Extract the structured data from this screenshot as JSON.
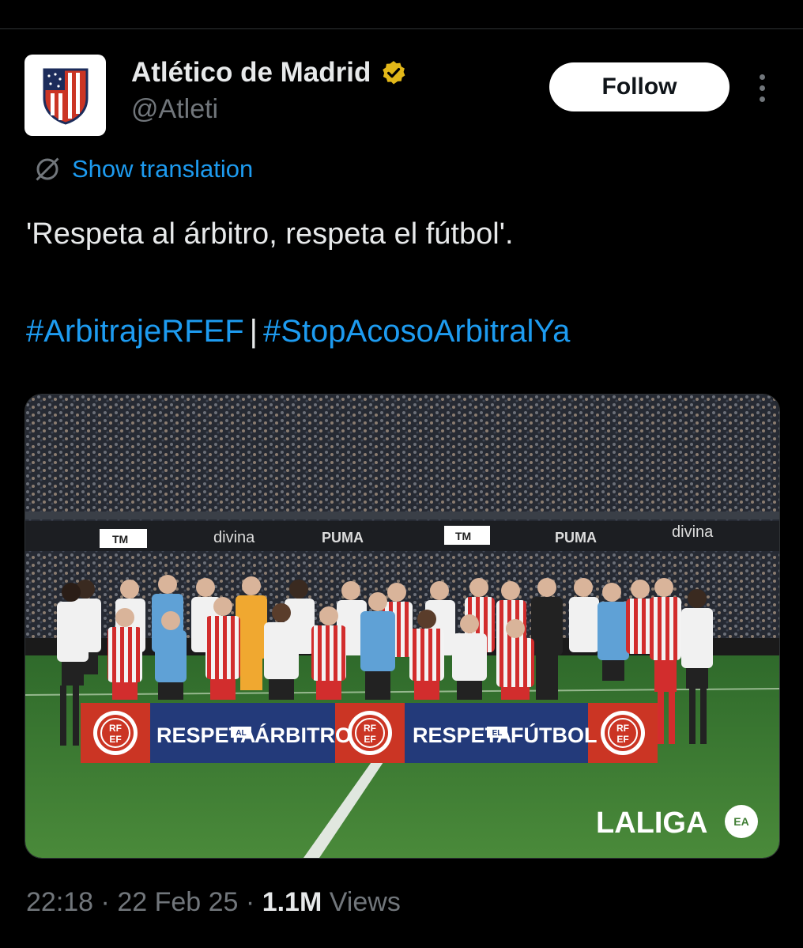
{
  "account": {
    "display_name": "Atlético de Madrid",
    "handle": "@Atleti",
    "avatar": "atletico-crest-logo",
    "verified_icon": "gold-verified-badge-icon"
  },
  "actions": {
    "follow_label": "Follow",
    "more_icon": "more-vertical-icon"
  },
  "translation": {
    "label": "Show translation",
    "icon": "globe-translate-icon"
  },
  "tweet": {
    "text": "'Respeta al árbitro, respeta el fútbol'.",
    "hashtags": [
      "#ArbitrajeRFEF",
      "#StopAcosoArbitralYa"
    ],
    "hashtag_separator": "|"
  },
  "media": {
    "banner_left": "RESPETA",
    "banner_left_small": "AL",
    "banner_left_end": "ÁRBITRO",
    "banner_right": "RESPETA",
    "banner_right_small": "EL",
    "banner_right_end": "FÚTBOL",
    "rfef_line1": "RF",
    "rfef_line2": "EF",
    "ad_1": "divina",
    "ad_2": "PUMA",
    "ad_3": "TM",
    "watermark": "LALIGA",
    "watermark_badge": "EA"
  },
  "meta": {
    "time": "22:18",
    "date": "22 Feb 25",
    "views_count": "1.1M",
    "views_label": "Views",
    "dot": "·"
  },
  "colors": {
    "background": "#000000",
    "accent_blue": "#1d9bf0",
    "muted": "#71767b",
    "verified_gold": "#e2b719",
    "atleti_red": "#cb3524",
    "banner_navy": "#233a7a",
    "pitch_green": "#3f7d34"
  }
}
